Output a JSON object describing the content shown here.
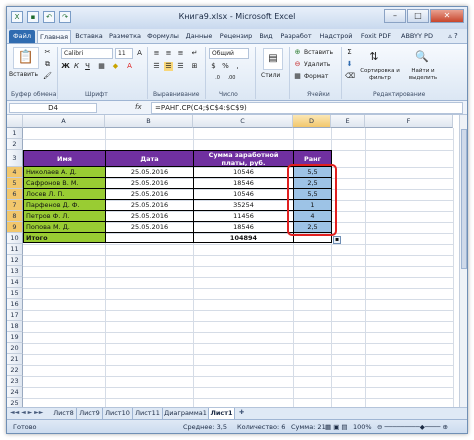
{
  "window": {
    "title": "Книга9.xlsx - Microsoft Excel",
    "minimize": "–",
    "maximize": "□",
    "close": "✕"
  },
  "ribbon_tabs": [
    "Файл",
    "Главная",
    "Вставка",
    "Разметка",
    "Формулы",
    "Данные",
    "Рецензир",
    "Вид",
    "Разработ",
    "Надстрой",
    "Foxit PDF",
    "ABBYY PD"
  ],
  "ribbon": {
    "paste_label": "Вставить",
    "clipboard_group": "Буфер обмена",
    "font_name": "Calibri",
    "font_size": "11",
    "font_group": "Шрифт",
    "alignment_group": "Выравнивание",
    "number_format": "Общий",
    "number_group": "Число",
    "styles_label": "Стили",
    "insert_label": "Вставить",
    "delete_label": "Удалить",
    "format_label": "Формат",
    "cells_group": "Ячейки",
    "sort_label": "Сортировка и фильтр",
    "find_label": "Найти и выделить",
    "editing_group": "Редактирование"
  },
  "formula_bar": {
    "name_box": "D4",
    "fx": "fx",
    "formula": "=РАНГ.СР(C4;$C$4:$C$9)"
  },
  "columns": [
    "A",
    "B",
    "C",
    "D",
    "E",
    "F"
  ],
  "rows": [
    "1",
    "2",
    "3",
    "4",
    "5",
    "6",
    "7",
    "8",
    "9",
    "10",
    "11",
    "12",
    "13",
    "14",
    "15",
    "16",
    "17",
    "18",
    "19",
    "20",
    "21",
    "22",
    "23",
    "24",
    "25"
  ],
  "table": {
    "headers": [
      "Имя",
      "Дата",
      "Сумма заработной платы, руб.",
      "Ранг"
    ],
    "rows": [
      [
        "Николаев А. Д.",
        "25.05.2016",
        "10546",
        "5,5"
      ],
      [
        "Сафронов В. М.",
        "25.05.2016",
        "18546",
        "2,5"
      ],
      [
        "Лосев Л. П.",
        "25.05.2016",
        "10546",
        "5,5"
      ],
      [
        "Парфенов Д. Ф.",
        "25.05.2016",
        "35254",
        "1"
      ],
      [
        "Петров Ф. Л.",
        "25.05.2016",
        "11456",
        "4"
      ],
      [
        "Попова М. Д.",
        "25.05.2016",
        "18546",
        "2,5"
      ]
    ],
    "total_label": "Итого",
    "total_value": "104894"
  },
  "sheet_tabs": [
    "Лист8",
    "Лист9",
    "Лист10",
    "Лист11",
    "Диаграмма1",
    "Лист1"
  ],
  "status": {
    "ready": "Готово",
    "average": "Среднее: 3,5",
    "count": "Количество: 6",
    "sum": "Сумма: 21",
    "zoom": "100%"
  },
  "colors": {
    "header_fill": "#7030a0",
    "name_fill": "#99cc33",
    "rank_fill": "#9dc3e6",
    "highlight_outline": "#e02020"
  }
}
